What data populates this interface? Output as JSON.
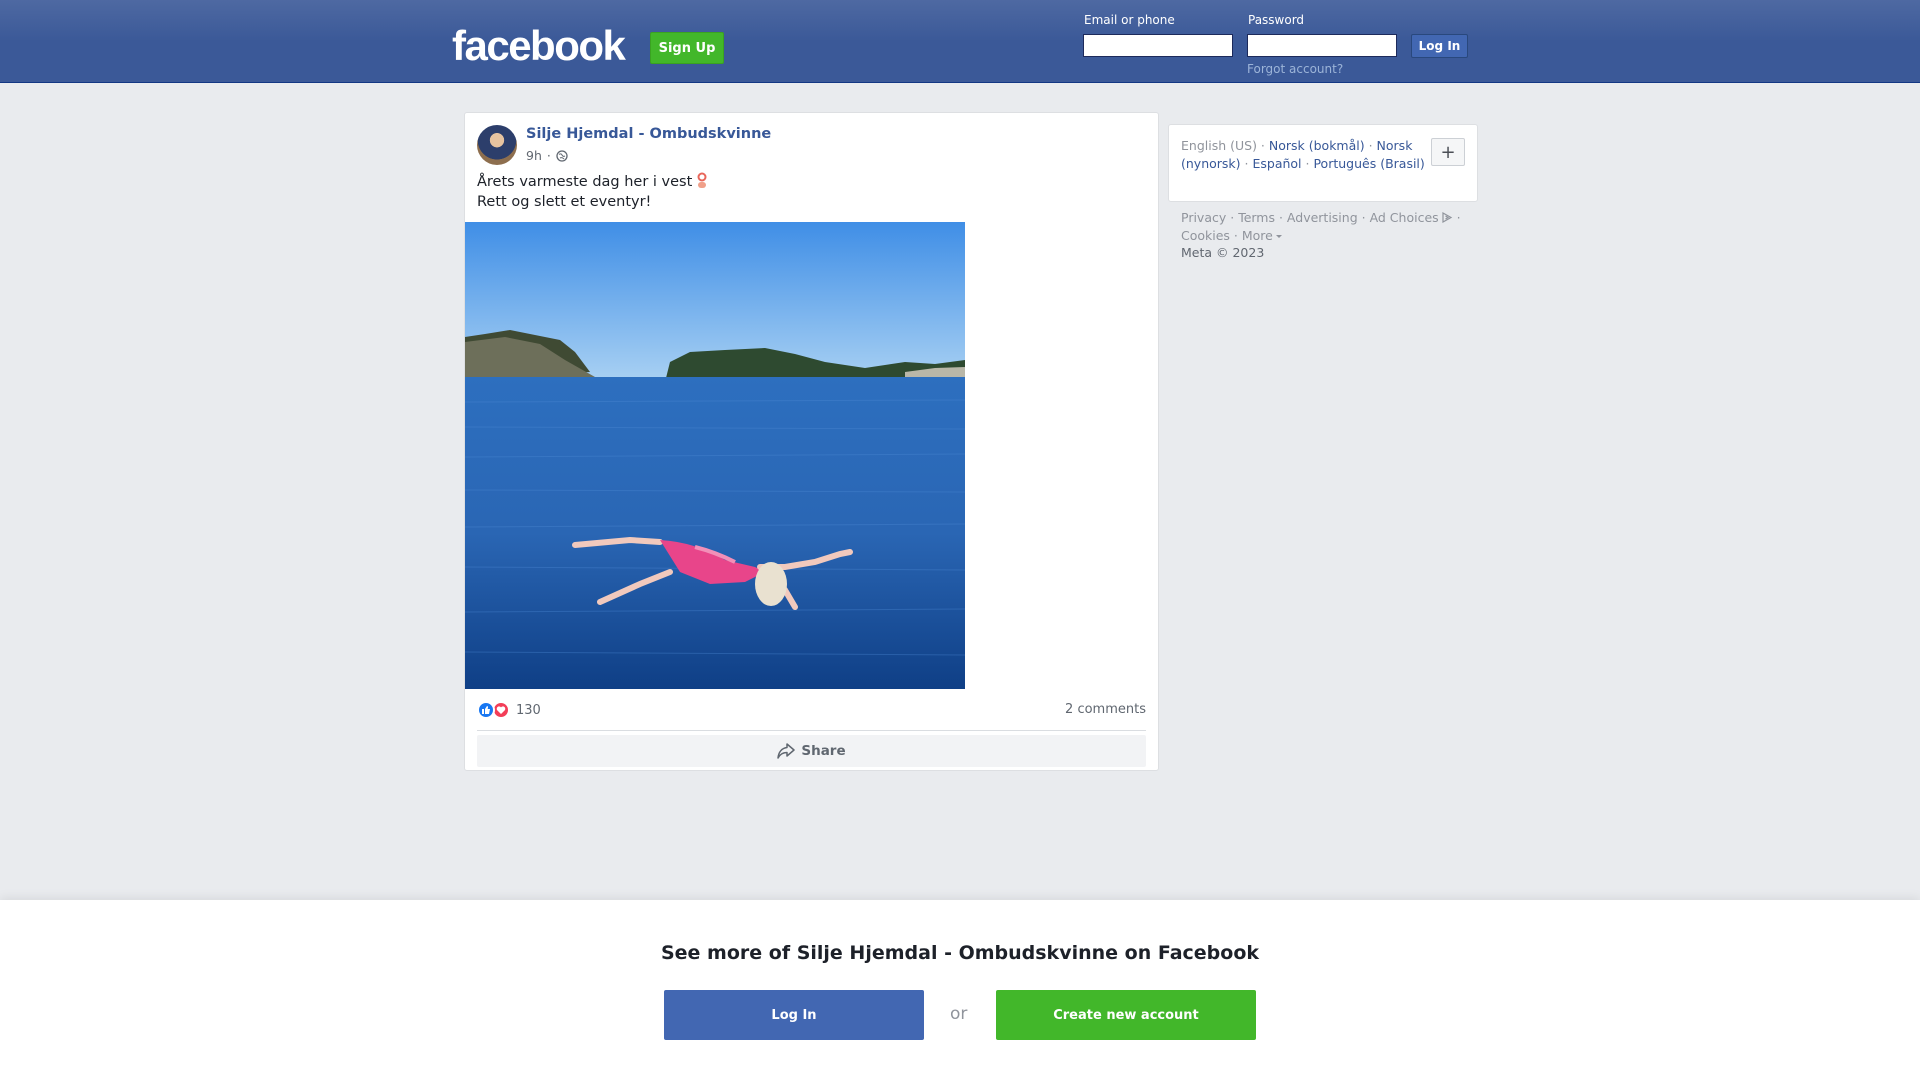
{
  "header": {
    "logo": "facebook",
    "signup_label": "Sign Up",
    "email_label": "Email or phone",
    "password_label": "Password",
    "email_value": "",
    "password_value": "",
    "login_label": "Log In",
    "forgot_label": "Forgot account?"
  },
  "post": {
    "author": "Silje Hjemdal - Ombudskvinne",
    "time": "9h",
    "time_separator": "·",
    "privacy_icon": "globe-icon",
    "text_line1": "Årets varmeste dag her i vest",
    "text_line2": "Rett og slett et eventyr!",
    "emoji_icon": "ring-buoy-icon",
    "reaction_icons": [
      "like-icon",
      "love-icon"
    ],
    "reaction_count": "130",
    "comments": "2 comments",
    "share_label": "Share"
  },
  "sidebar": {
    "languages": [
      {
        "label": "English (US)",
        "active": true
      },
      {
        "label": "Norsk (bokmål)",
        "active": false
      },
      {
        "label": "Norsk (nynorsk)",
        "active": false
      },
      {
        "label": "Español",
        "active": false
      },
      {
        "label": "Português (Brasil)",
        "active": false
      }
    ],
    "more_languages_label": "+",
    "footer_links": [
      "Privacy",
      "Terms",
      "Advertising",
      "Ad Choices",
      "Cookies",
      "More"
    ],
    "copyright": "Meta © 2023"
  },
  "banner": {
    "title": "See more of Silje Hjemdal - Ombudskvinne on Facebook",
    "login_label": "Log In",
    "or_label": "or",
    "create_label": "Create new account"
  },
  "colors": {
    "header": "#3b5998",
    "link": "#385898",
    "green": "#42b72a",
    "login_blue": "#4267b2"
  }
}
